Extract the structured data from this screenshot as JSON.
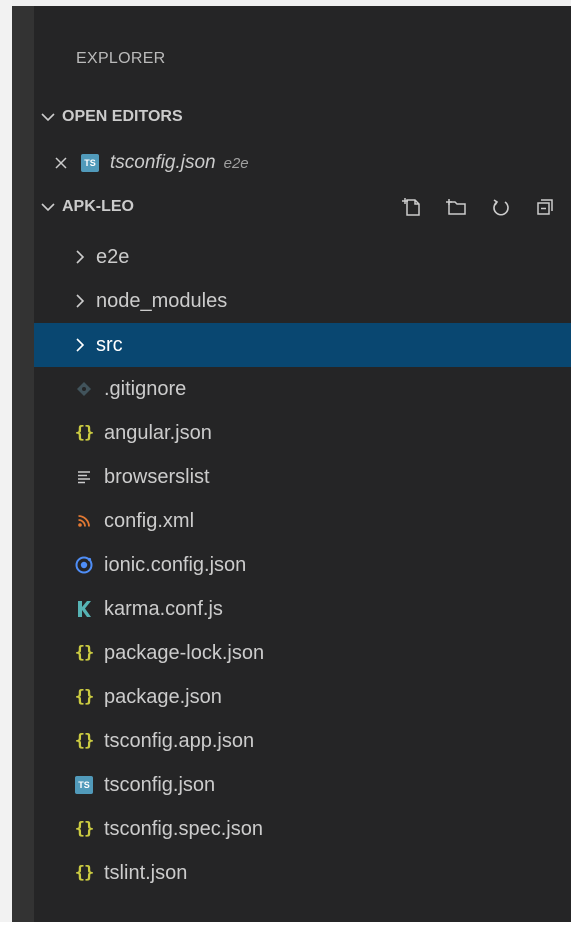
{
  "explorer": {
    "title": "EXPLORER"
  },
  "open_editors": {
    "header": "OPEN EDITORS",
    "items": [
      {
        "name": "tsconfig.json",
        "description": "e2e",
        "icon": "ts-file-icon"
      }
    ]
  },
  "workspace": {
    "header": "APK-LEO",
    "actions": [
      "new-file-icon",
      "new-folder-icon",
      "refresh-icon",
      "collapse-all-icon"
    ],
    "folders": [
      {
        "name": "e2e"
      },
      {
        "name": "node_modules"
      },
      {
        "name": "src",
        "selected": true
      }
    ],
    "files": [
      {
        "name": ".gitignore",
        "icon": "git-icon"
      },
      {
        "name": "angular.json",
        "icon": "json-icon"
      },
      {
        "name": "browserslist",
        "icon": "text-lines-icon"
      },
      {
        "name": "config.xml",
        "icon": "rss-icon"
      },
      {
        "name": "ionic.config.json",
        "icon": "ionic-icon"
      },
      {
        "name": "karma.conf.js",
        "icon": "karma-icon"
      },
      {
        "name": "package-lock.json",
        "icon": "json-icon"
      },
      {
        "name": "package.json",
        "icon": "json-icon"
      },
      {
        "name": "tsconfig.app.json",
        "icon": "json-icon"
      },
      {
        "name": "tsconfig.json",
        "icon": "ts-file-icon"
      },
      {
        "name": "tsconfig.spec.json",
        "icon": "json-icon"
      },
      {
        "name": "tslint.json",
        "icon": "json-icon"
      }
    ]
  },
  "colors": {
    "sidebar_bg": "#252526",
    "selection_bg": "#094771",
    "json_icon": "#cbcb41",
    "ts_icon": "#519aba",
    "ionic_icon": "#4f8ef7",
    "karma_icon": "#56b3b4",
    "rss_icon": "#e37933",
    "git_icon": "#41535b"
  }
}
